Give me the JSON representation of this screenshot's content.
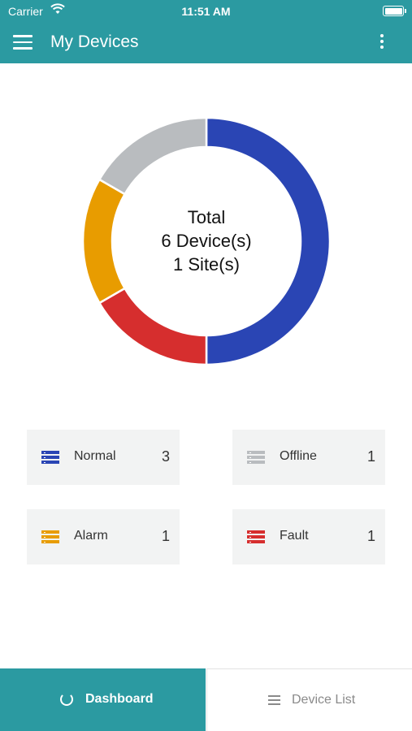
{
  "status_bar": {
    "carrier": "Carrier",
    "time": "11:51 AM"
  },
  "app_bar": {
    "title": "My Devices",
    "menu_icon": "hamburger-menu-icon",
    "more_icon": "more-vertical-icon"
  },
  "summary": {
    "line1": "Total",
    "line2": "6 Device(s)",
    "line3": "1 Site(s)"
  },
  "chart_data": {
    "type": "pie",
    "style": "donut",
    "categories": [
      "Normal",
      "Fault",
      "Alarm",
      "Offline"
    ],
    "values": [
      3,
      1,
      1,
      1
    ],
    "colors": [
      "#2a45b4",
      "#d62e2e",
      "#e89c00",
      "#b9bcbf"
    ]
  },
  "status_cards": [
    {
      "label": "Normal",
      "count": "3",
      "color": "#2a45b4",
      "icon": "server-list-icon"
    },
    {
      "label": "Offline",
      "count": "1",
      "color": "#b9bcbf",
      "icon": "server-list-icon"
    },
    {
      "label": "Alarm",
      "count": "1",
      "color": "#e89c00",
      "icon": "server-list-icon"
    },
    {
      "label": "Fault",
      "count": "1",
      "color": "#d62e2e",
      "icon": "server-list-icon"
    }
  ],
  "tabs": [
    {
      "label": "Dashboard",
      "icon": "dashboard-icon",
      "active": true
    },
    {
      "label": "Device List",
      "icon": "list-icon",
      "active": false
    }
  ],
  "colors": {
    "accent": "#2b9aa1"
  }
}
